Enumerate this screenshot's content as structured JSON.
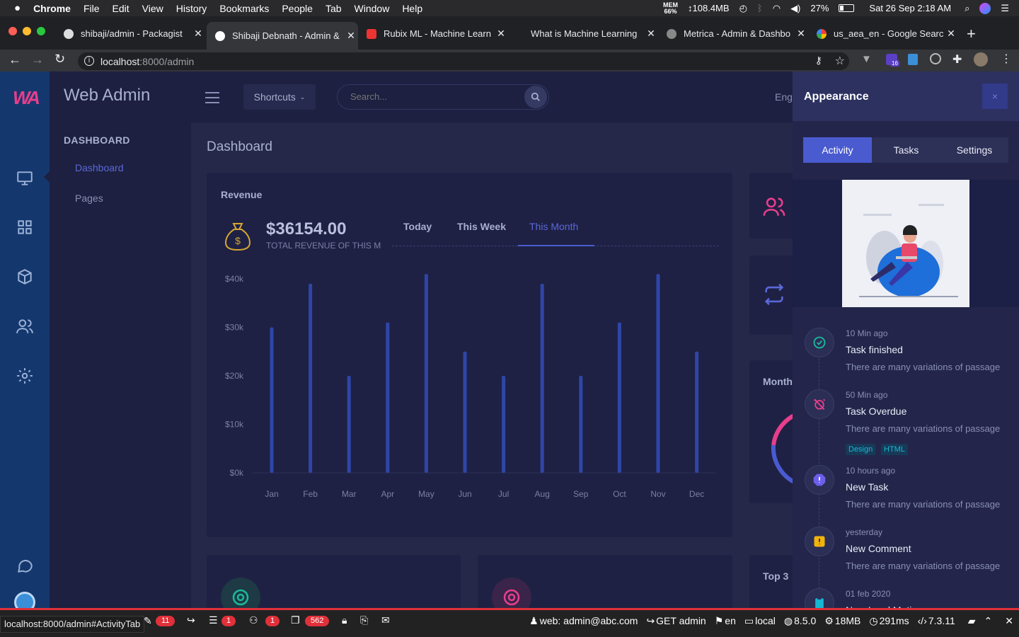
{
  "menubar": {
    "apple": "",
    "items": [
      "Chrome",
      "File",
      "Edit",
      "View",
      "History",
      "Bookmarks",
      "People",
      "Tab",
      "Window",
      "Help"
    ],
    "mem_label": "MEM",
    "mem_value": "66%",
    "net_speed": "↕108.4MB",
    "battery": "27%",
    "datetime": "Sat 26 Sep  2:18 AM"
  },
  "tabs": [
    {
      "title": "shibaji/admin - Packagist",
      "active": false
    },
    {
      "title": "Shibaji Debnath - Admin &",
      "active": true
    },
    {
      "title": "Rubix ML - Machine Learn",
      "active": false
    },
    {
      "title": "What is Machine Learning",
      "active": false
    },
    {
      "title": "Metrica - Admin & Dashbo",
      "active": false
    },
    {
      "title": "us_aea_en - Google Searc",
      "active": false
    }
  ],
  "address": {
    "host": "localhost",
    "path": ":8000/admin",
    "extension_badge": "16"
  },
  "app": {
    "logo": "WA",
    "title": "Web Admin",
    "shortcuts_label": "Shortcuts",
    "search_placeholder": "Search...",
    "lang_label": "Eng"
  },
  "sidebar": {
    "section": "DASHBOARD",
    "items": [
      {
        "label": "Dashboard",
        "active": true
      },
      {
        "label": "Pages",
        "active": false
      }
    ]
  },
  "page": {
    "title": "Dashboard"
  },
  "revenue": {
    "card_title": "Revenue",
    "amount": "$36154.00",
    "caption": "TOTAL REVENUE OF THIS M",
    "tabs": [
      "Today",
      "This Week",
      "This Month"
    ],
    "active_tab": "This Month"
  },
  "chart_data": {
    "type": "bar",
    "categories": [
      "Jan",
      "Feb",
      "Mar",
      "Apr",
      "May",
      "Jun",
      "Jul",
      "Aug",
      "Sep",
      "Oct",
      "Nov",
      "Dec"
    ],
    "values": [
      30000,
      39000,
      20000,
      31000,
      41000,
      25000,
      20000,
      39000,
      20000,
      31000,
      41000,
      25000
    ],
    "ylim": [
      0,
      40000
    ],
    "yticks": [
      "$0k",
      "$10k",
      "$20k",
      "$30k",
      "$40k"
    ],
    "grid": false,
    "color": "#2f46a8"
  },
  "side_cards": {
    "month_label": "Month",
    "top_label": "Top 3"
  },
  "panel": {
    "title": "Appearance",
    "close": "×",
    "tabs": [
      "Activity",
      "Tasks",
      "Settings"
    ],
    "active_tab": "Activity",
    "activities": [
      {
        "time": "10 Min ago",
        "title": "Task finished",
        "desc": "There are many variations of passage",
        "color": "#1bb99a",
        "icon": "check-icon"
      },
      {
        "time": "50 Min ago",
        "title": "Task Overdue",
        "desc": "There are many variations of passage",
        "tags": [
          "Design",
          "HTML"
        ],
        "color": "#e83e8c",
        "icon": "alarm-off-icon"
      },
      {
        "time": "10 hours ago",
        "title": "New Task",
        "desc": "There are many variations of passage",
        "color": "#6d5fea",
        "icon": "alert-octagon-icon"
      },
      {
        "time": "yesterday",
        "title": "New Comment",
        "desc": "There are many variations of passage",
        "color": "#f2b40c",
        "icon": "alert-icon"
      },
      {
        "time": "01 feb 2020",
        "title": "New Lead Meting",
        "desc": "",
        "color": "#14b8d4",
        "icon": "clipboard-icon"
      }
    ]
  },
  "statusbar": {
    "url_tooltip": "localhost:8000/admin#ActivityTab",
    "counts": [
      "11",
      "1",
      "1",
      "562"
    ],
    "user": "web: admin@abc.com",
    "route": "GET admin",
    "locale": "en",
    "env": "local",
    "laravel": "8.5.0",
    "memory": "18MB",
    "time": "291ms",
    "php": "7.3.11"
  }
}
